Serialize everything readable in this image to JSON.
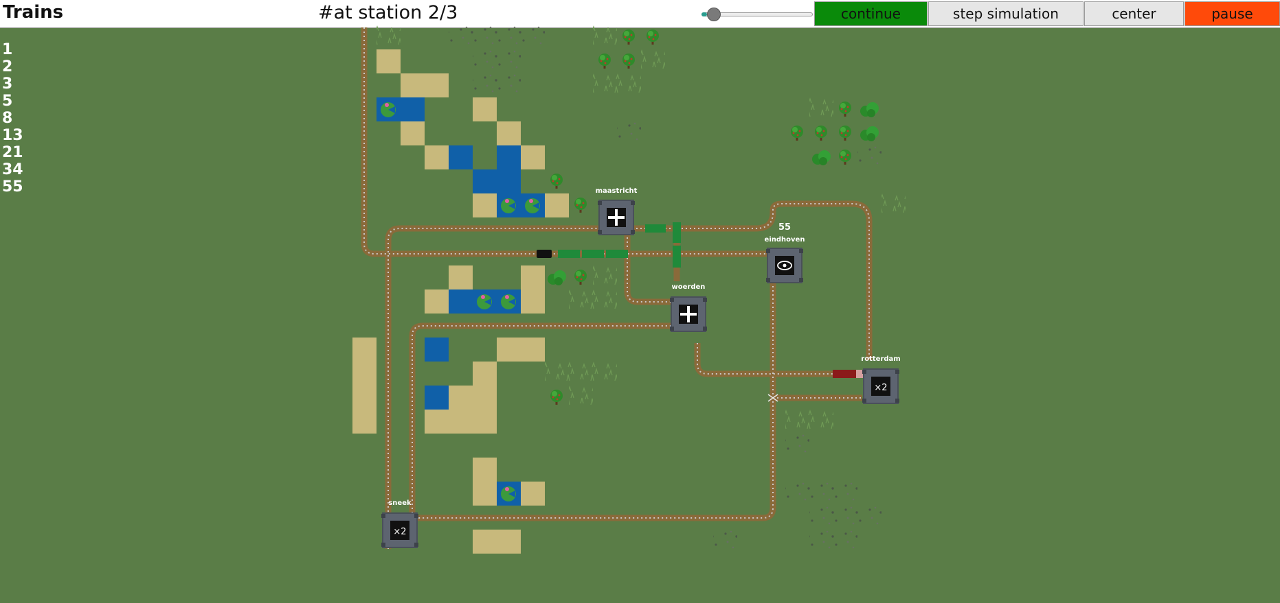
{
  "app": {
    "title": "Trains"
  },
  "status": {
    "text": "#at station 2/3"
  },
  "controls": {
    "speed": {
      "value": 0.05
    },
    "continue": {
      "label": "continue",
      "color": "#0a8a0a"
    },
    "step": {
      "label": "step simulation",
      "color": "#e6e6e6"
    },
    "center": {
      "label": "center",
      "color": "#e6e6e6"
    },
    "pause": {
      "label": "pause",
      "color": "#ff4a0a"
    }
  },
  "sequence": [
    "1",
    "2",
    "3",
    "5",
    "8",
    "13",
    "21",
    "34",
    "55"
  ],
  "stations": {
    "maastricht": {
      "name": "maastricht",
      "icon": "plus-icon"
    },
    "eindhoven": {
      "name": "eindhoven",
      "icon": "eye-icon",
      "value": "55"
    },
    "woerden": {
      "name": "woerden",
      "icon": "plus-icon"
    },
    "rotterdam": {
      "name": "rotterdam",
      "icon": "times-two-icon",
      "label": "×2"
    },
    "sneek": {
      "name": "sneek",
      "icon": "times-two-icon",
      "label": "×2"
    }
  },
  "trains": [
    {
      "id": "green-train",
      "color": "#1f8a3a"
    },
    {
      "id": "red-train",
      "color": "#8b1a1a"
    }
  ],
  "colors": {
    "grass": "#5a7d47",
    "sand": "#c8b97c",
    "water": "#1060a8",
    "station": "#5d6470",
    "rail": "#8a6a3a"
  }
}
